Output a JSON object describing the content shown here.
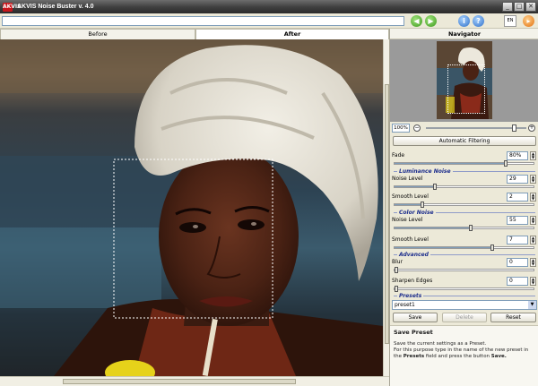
{
  "window": {
    "title": "AKVIS Noise Buster v. 4.0",
    "logo_text": "AKVIS",
    "min": "_",
    "max": "□",
    "close": "✕"
  },
  "toolbar": {
    "path_value": "",
    "language": "EN"
  },
  "tabs": {
    "before": "Before",
    "after": "After"
  },
  "navigator": {
    "title": "Navigator",
    "zoom_value": "100%",
    "zoom_fraction": 0.88
  },
  "settings": {
    "auto_button": "Automatic Filtering",
    "fade": {
      "label": "Fade",
      "value": "80%",
      "fraction": 0.8
    },
    "luminance_title": "Luminance Noise",
    "lum_noise": {
      "label": "Noise Level",
      "value": "29",
      "fraction": 0.29
    },
    "lum_smooth": {
      "label": "Smooth Level",
      "value": "2",
      "fraction": 0.2
    },
    "color_title": "Color Noise",
    "color_noise": {
      "label": "Noise Level",
      "value": "55",
      "fraction": 0.55
    },
    "color_smooth": {
      "label": "Smooth Level",
      "value": "7",
      "fraction": 0.7
    },
    "advanced_title": "Advanced",
    "blur": {
      "label": "Blur",
      "value": "0",
      "fraction": 0.0
    },
    "sharpen": {
      "label": "Sharpen Edges",
      "value": "0",
      "fraction": 0.0
    }
  },
  "presets": {
    "title": "Presets",
    "selected": "preset1",
    "save": "Save",
    "delete": "Delete",
    "reset": "Reset"
  },
  "help": {
    "title": "Save Preset",
    "line1": "Save the current settings as a Preset.",
    "line2_a": "For this purpose type in the name of the new preset in",
    "line2_b": "the",
    "line2_bold": "Presets",
    "line2_c": "field and press the button",
    "line2_bold2": "Save."
  }
}
